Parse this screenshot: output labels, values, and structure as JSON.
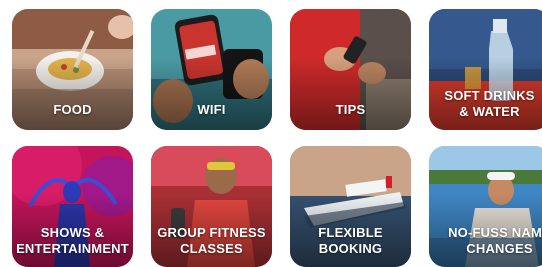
{
  "tiles": [
    {
      "label": "FOOD"
    },
    {
      "label": "WIFI"
    },
    {
      "label": "TIPS"
    },
    {
      "label": "SOFT DRINKS\n& WATER"
    },
    {
      "label": "SHOWS &\nENTERTAINMENT"
    },
    {
      "label": "GROUP FITNESS\nCLASSES"
    },
    {
      "label": "FLEXIBLE\nBOOKING"
    },
    {
      "label": "NO-FUSS NAME\nCHANGES"
    }
  ],
  "colors": {
    "brand_red": "#e10a0a",
    "label_text": "#ffffff"
  }
}
